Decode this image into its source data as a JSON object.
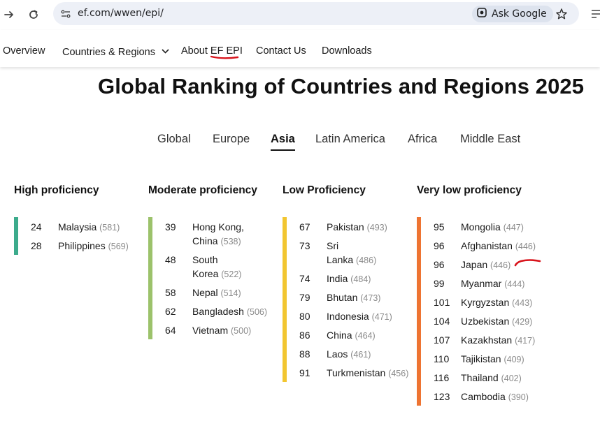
{
  "browser": {
    "url": "ef.com/wwen/epi/",
    "ask_google_label": "Ask Google"
  },
  "site_nav": {
    "items": [
      "Overview",
      "Countries & Regions",
      "About EF EPI",
      "Contact Us",
      "Downloads"
    ]
  },
  "page": {
    "title": "Global Ranking of Countries and Regions 2025"
  },
  "region_tabs": {
    "items": [
      "Global",
      "Europe",
      "Asia",
      "Latin America",
      "Africa",
      "Middle East"
    ],
    "active": "Asia"
  },
  "colors": {
    "high": "#3cab8c",
    "moderate": "#9cc26b",
    "low": "#f2c630",
    "very_low": "#ee7432",
    "annotation": "#d8141c"
  },
  "columns": [
    {
      "heading": "High proficiency",
      "entries": [
        {
          "rank": "24",
          "country": "Malaysia",
          "score": "(581)"
        },
        {
          "rank": "28",
          "country": "Philippines",
          "score": "(569)"
        }
      ]
    },
    {
      "heading": "Moderate proficiency",
      "entries": [
        {
          "rank": "39",
          "country_l1": "Hong Kong,",
          "country_l2": "China",
          "score": "(538)"
        },
        {
          "rank": "48",
          "country_l1": "South",
          "country_l2": "Korea",
          "score": "(522)"
        },
        {
          "rank": "58",
          "country": "Nepal",
          "score": "(514)"
        },
        {
          "rank": "62",
          "country": "Bangladesh",
          "score": "(506)"
        },
        {
          "rank": "64",
          "country": "Vietnam",
          "score": "(500)"
        }
      ]
    },
    {
      "heading": "Low Proficiency",
      "entries": [
        {
          "rank": "67",
          "country": "Pakistan",
          "score": "(493)"
        },
        {
          "rank": "73",
          "country_l1": "Sri",
          "country_l2": "Lanka",
          "score": "(486)"
        },
        {
          "rank": "74",
          "country": "India",
          "score": "(484)"
        },
        {
          "rank": "79",
          "country": "Bhutan",
          "score": "(473)"
        },
        {
          "rank": "80",
          "country": "Indonesia",
          "score": "(471)"
        },
        {
          "rank": "86",
          "country": "China",
          "score": "(464)"
        },
        {
          "rank": "88",
          "country": "Laos",
          "score": "(461)"
        },
        {
          "rank": "91",
          "country": "Turkmenistan",
          "score": "(456)"
        }
      ]
    },
    {
      "heading": "Very low proficiency",
      "entries": [
        {
          "rank": "95",
          "country": "Mongolia",
          "score": "(447)"
        },
        {
          "rank": "96",
          "country": "Afghanistan",
          "score": "(446)"
        },
        {
          "rank": "96",
          "country": "Japan",
          "score": "(446)"
        },
        {
          "rank": "99",
          "country": "Myanmar",
          "score": "(444)"
        },
        {
          "rank": "101",
          "country": "Kyrgyzstan",
          "score": "(443)"
        },
        {
          "rank": "104",
          "country": "Uzbekistan",
          "score": "(429)"
        },
        {
          "rank": "107",
          "country": "Kazakhstan",
          "score": "(417)"
        },
        {
          "rank": "110",
          "country": "Tajikistan",
          "score": "(409)"
        },
        {
          "rank": "116",
          "country": "Thailand",
          "score": "(402)"
        },
        {
          "rank": "123",
          "country": "Cambodia",
          "score": "(390)"
        }
      ]
    }
  ]
}
